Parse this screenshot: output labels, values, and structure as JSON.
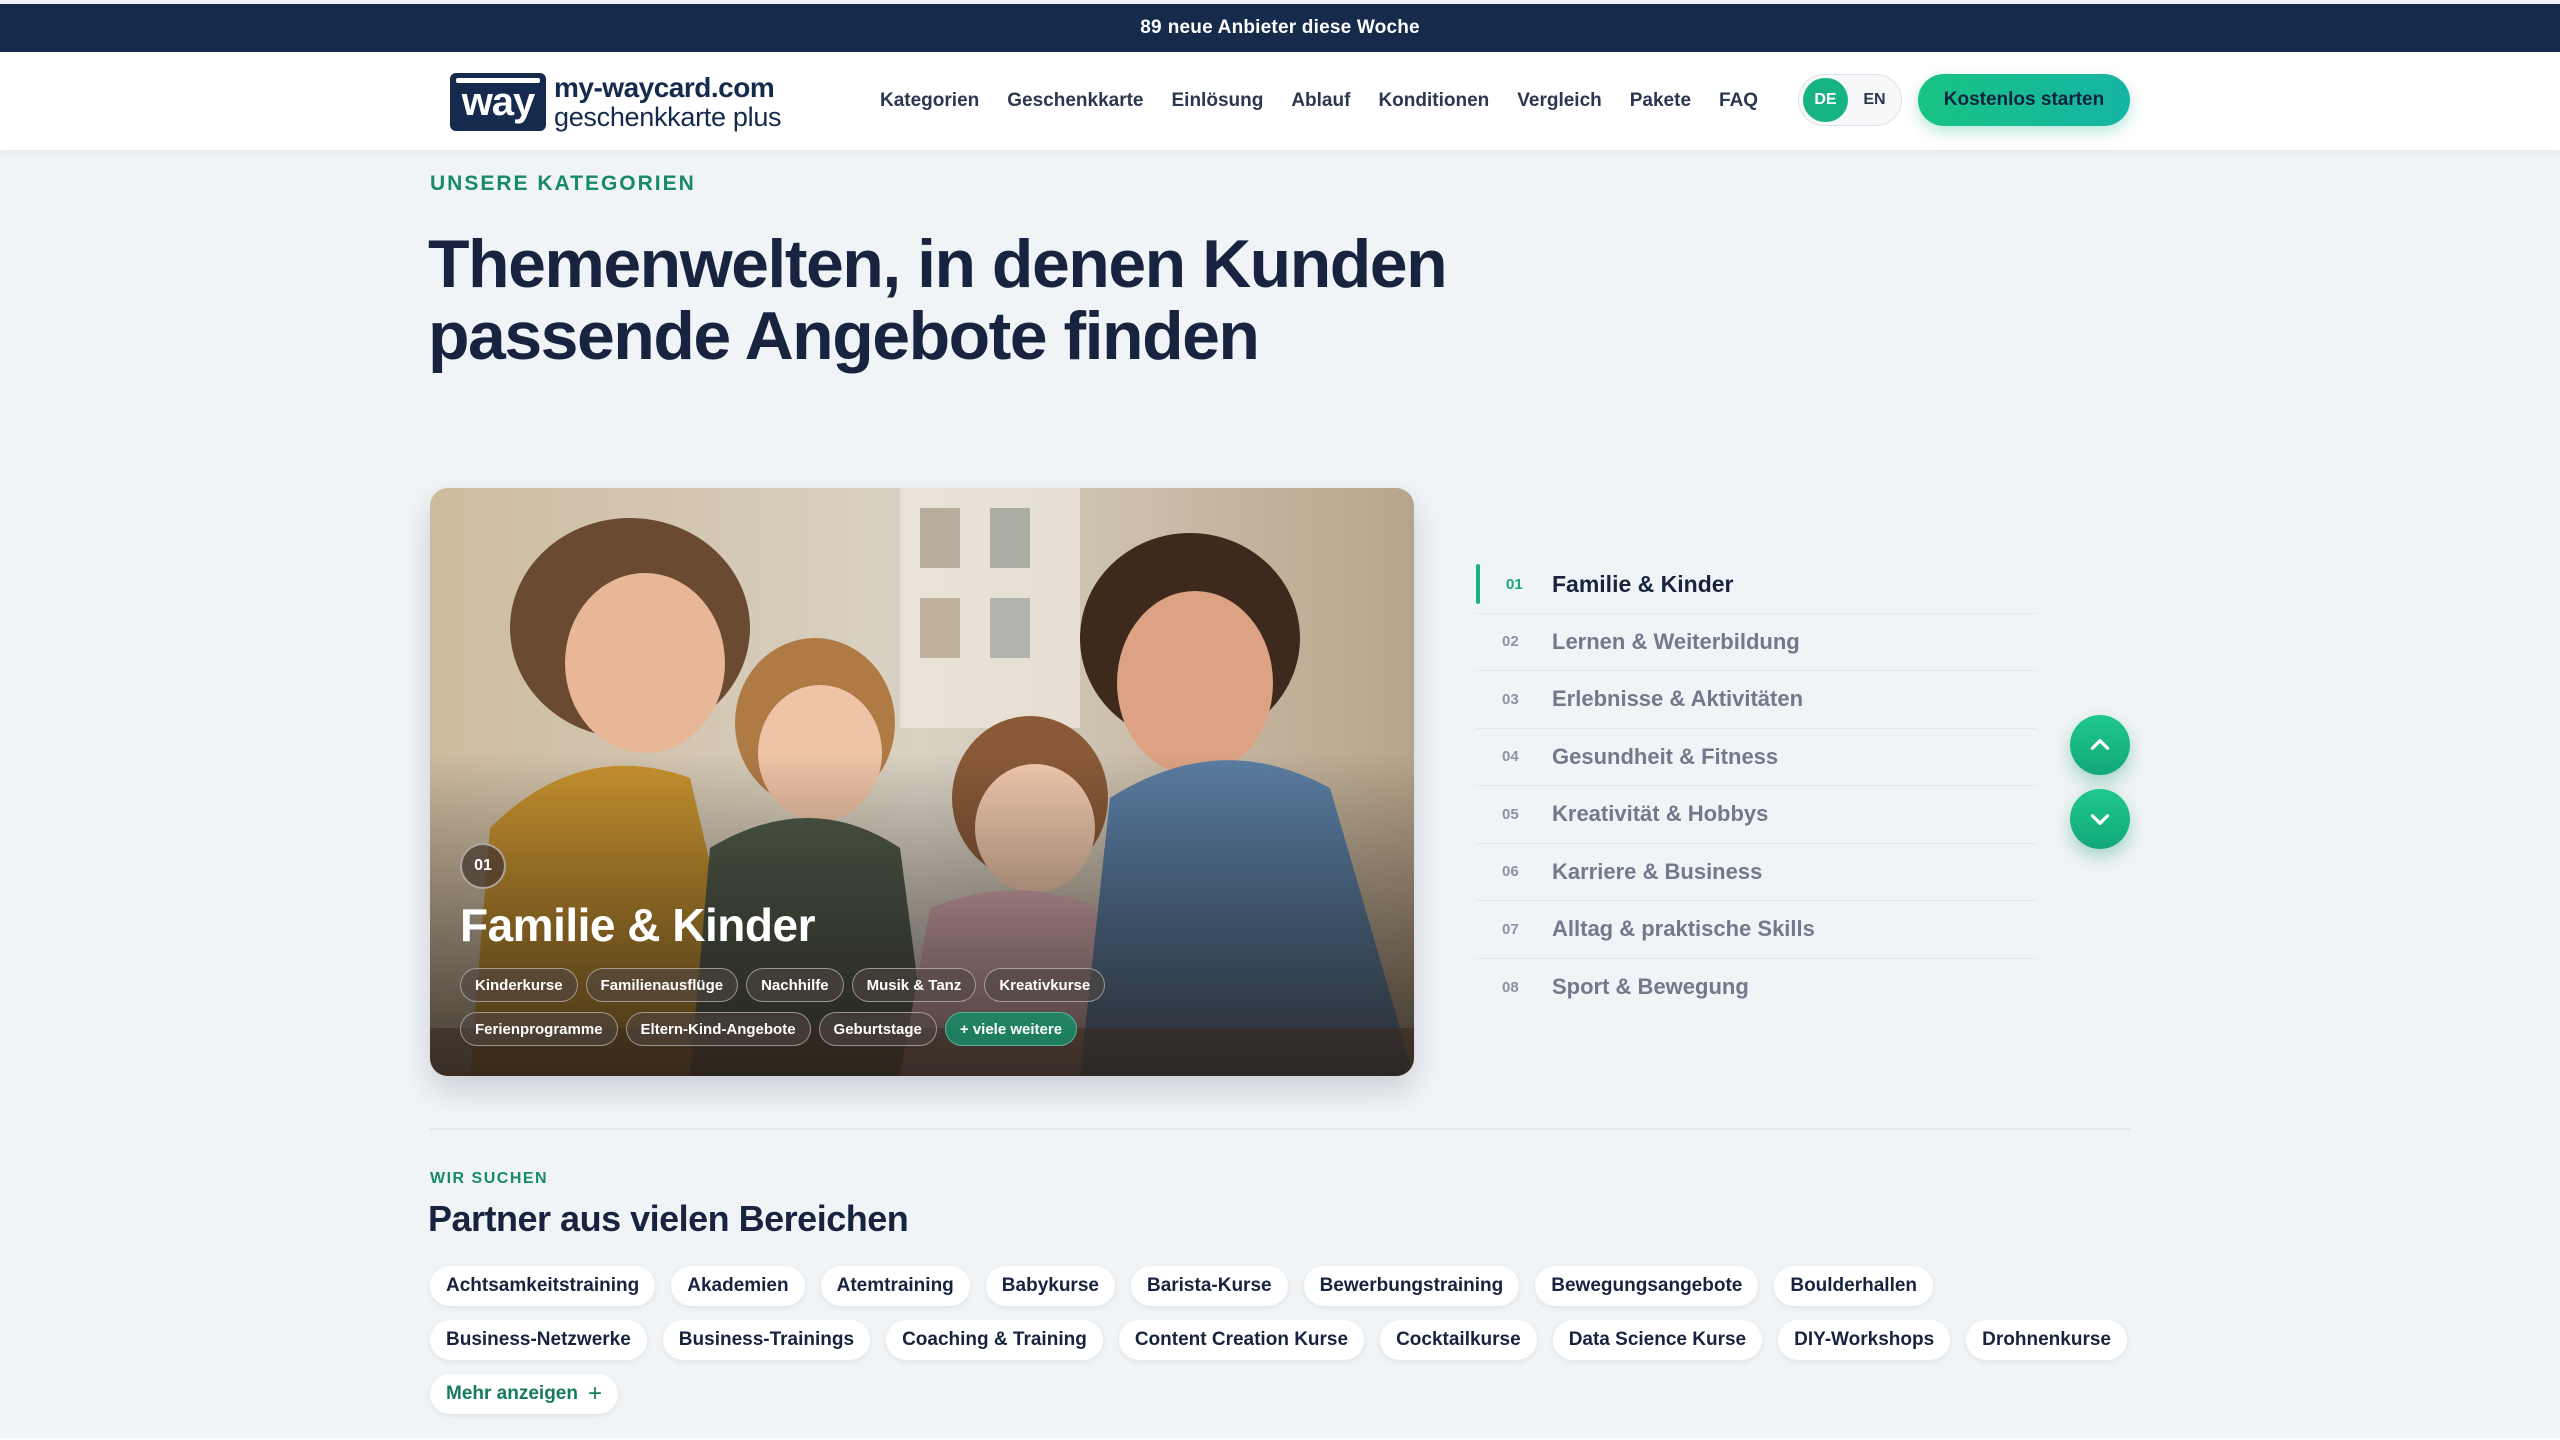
{
  "announcement": {
    "count": "89",
    "text": "neue Anbieter diese Woche"
  },
  "header": {
    "logo_badge": "way",
    "logo_line1": "my-waycard.com",
    "logo_line2": "geschenkkarte plus",
    "nav": [
      "Kategorien",
      "Geschenkkarte",
      "Einlösung",
      "Ablauf",
      "Konditionen",
      "Vergleich",
      "Pakete",
      "FAQ"
    ],
    "lang_active": "DE",
    "lang_inactive": "EN",
    "cta_label": "Kostenlos starten"
  },
  "categories_section": {
    "eyebrow": "UNSERE KATEGORIEN",
    "headline": "Themenwelten, in denen Kunden passende Angebote finden",
    "hero": {
      "number": "01",
      "title": "Familie & Kinder",
      "tags": [
        "Kinderkurse",
        "Familienausflüge",
        "Nachhilfe",
        "Musik & Tanz",
        "Kreativkurse",
        "Ferienprogramme",
        "Eltern-Kind-Angebote",
        "Geburtstage"
      ],
      "more_tag": "+ viele weitere"
    },
    "list": [
      {
        "idx": "01",
        "label": "Familie & Kinder"
      },
      {
        "idx": "02",
        "label": "Lernen & Weiterbildung"
      },
      {
        "idx": "03",
        "label": "Erlebnisse & Aktivitäten"
      },
      {
        "idx": "04",
        "label": "Gesundheit & Fitness"
      },
      {
        "idx": "05",
        "label": "Kreativität & Hobbys"
      },
      {
        "idx": "06",
        "label": "Karriere & Business"
      },
      {
        "idx": "07",
        "label": "Alltag & praktische Skills"
      },
      {
        "idx": "08",
        "label": "Sport & Bewegung"
      }
    ],
    "active_index": 0
  },
  "partners_section": {
    "eyebrow": "WIR SUCHEN",
    "title": "Partner aus vielen Bereichen",
    "chips": [
      "Achtsamkeitstraining",
      "Akademien",
      "Atemtraining",
      "Babykurse",
      "Barista-Kurse",
      "Bewerbungstraining",
      "Bewegungsangebote",
      "Boulderhallen",
      "Business-Netzwerke",
      "Business-Trainings",
      "Coaching & Training",
      "Content Creation Kurse",
      "Cocktailkurse",
      "Data Science Kurse",
      "DIY-Workshops",
      "Drohnenkurse"
    ],
    "more_label": "Mehr anzeigen"
  },
  "colors": {
    "accent": "#17b483",
    "navy": "#162a4c",
    "text": "#17233f"
  }
}
